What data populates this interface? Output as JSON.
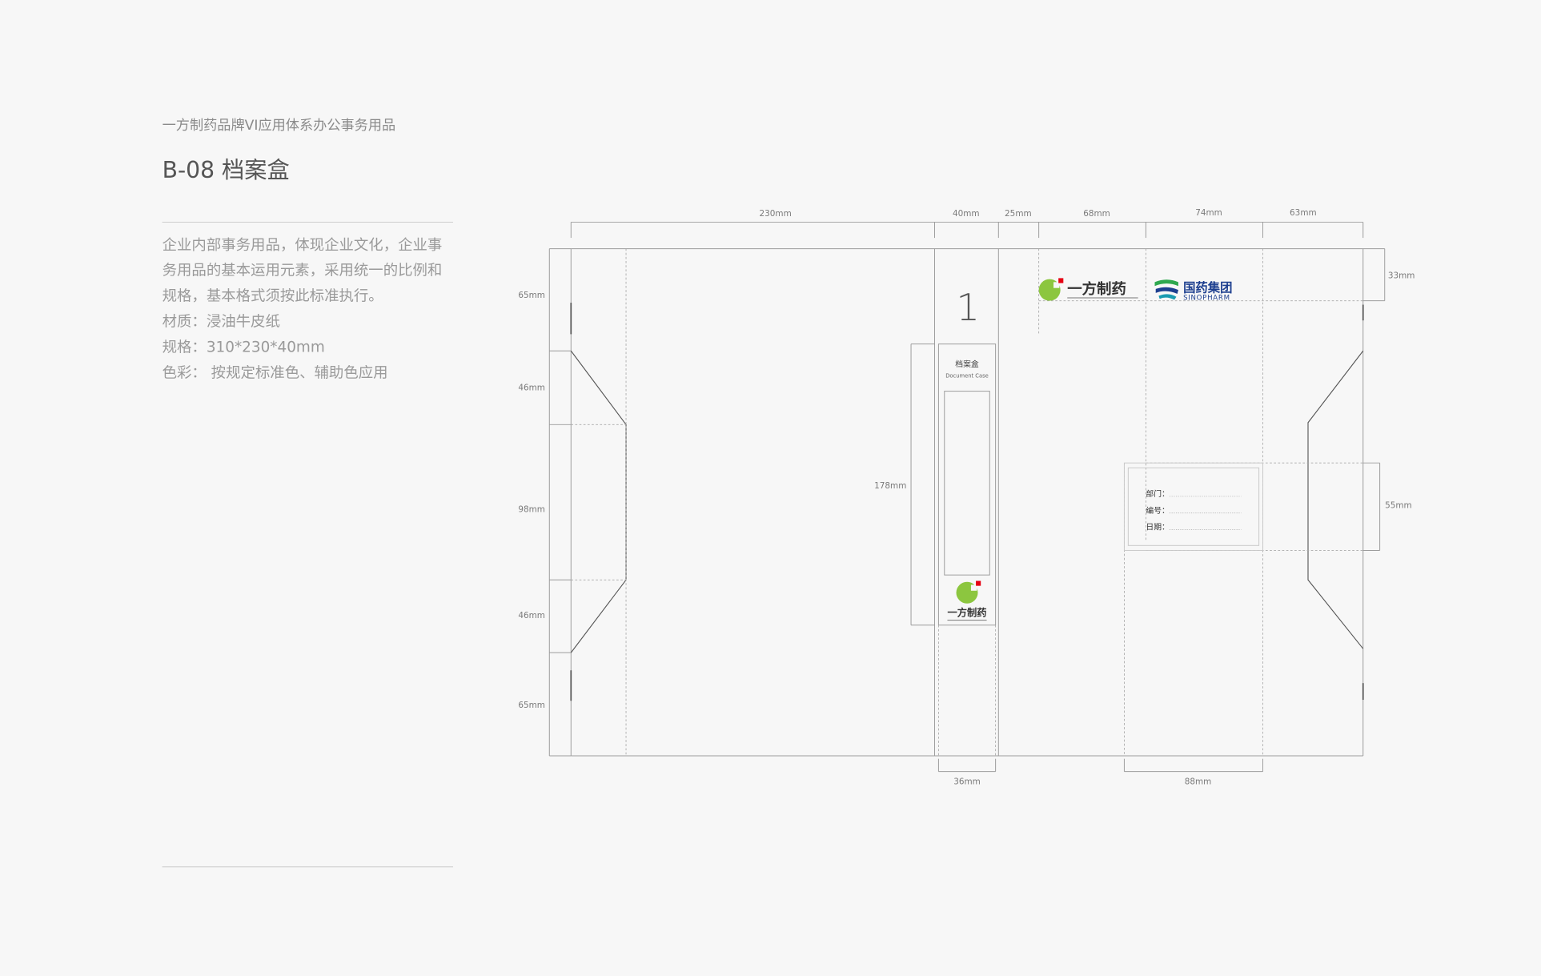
{
  "header": {
    "series_title": "一方制药品牌VI应用体系办公事务用品",
    "title": "B-08 档案盒"
  },
  "description": {
    "lines": [
      "企业内部事务用品，体现企业文化，企业事",
      "务用品的基本运用元素，采用统一的比例和",
      "规格，基本格式须按此标准执行。",
      "材质：浸油牛皮纸",
      "规格：310*230*40mm",
      "色彩： 按规定标准色、辅助色应用"
    ]
  },
  "dieline": {
    "top_dimensions": [
      "230mm",
      "40mm",
      "25mm",
      "68mm",
      "74mm",
      "63mm"
    ],
    "left_dimensions": [
      "65mm",
      "46mm",
      "98mm",
      "46mm",
      "65mm"
    ],
    "right_dimensions": [
      "33mm",
      "55mm"
    ],
    "spine_dimension": "178mm",
    "bottom_dimensions": [
      "36mm",
      "88mm"
    ],
    "spine_number": "1",
    "spine_label": {
      "title": "档案盒",
      "subtitle": "Document Case",
      "brand": "一方制药"
    },
    "info_label": {
      "fields": [
        "部门：",
        "编号：",
        "日期："
      ]
    },
    "top_logos": {
      "brand": "一方制药",
      "partner": "国药集团",
      "partner_en": "SINOPHARM"
    }
  },
  "colors": {
    "background": "#f7f7f7",
    "brand_green": "#8cc63f",
    "brand_red": "#e60012",
    "partner_blue": "#1d3f8f",
    "partner_green": "#2fa84f",
    "partner_teal": "#1a9bb0"
  }
}
